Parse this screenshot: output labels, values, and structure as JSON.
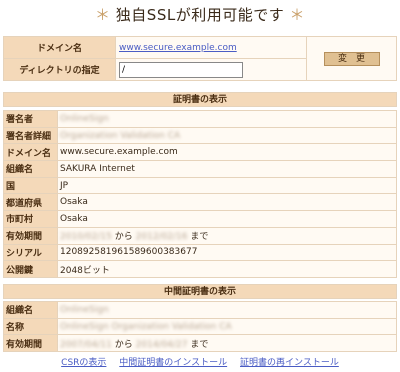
{
  "page": {
    "title_prefix": "＊",
    "title": "独自SSLが利用可能です",
    "title_suffix": "＊"
  },
  "form": {
    "domain_label": "ドメイン名",
    "domain_value": "www.secure.example.com",
    "dir_label": "ディレクトリの指定",
    "dir_value": "/",
    "change_button": "変　更"
  },
  "certificate": {
    "heading": "証明書の表示",
    "rows": [
      {
        "label": "署名者",
        "value": "OnlineSign"
      },
      {
        "label": "署名者詳細",
        "value": "Organization Validation CA"
      },
      {
        "label": "ドメイン名",
        "value": "www.secure.example.com"
      },
      {
        "label": "組織名",
        "value": "SAKURA Internet"
      },
      {
        "label": "国",
        "value": "JP"
      },
      {
        "label": "都道府県",
        "value": "Osaka"
      },
      {
        "label": "市町村",
        "value": "Osaka"
      }
    ],
    "validity": {
      "label": "有効期間",
      "from": "2010/02/15",
      "from_word": "から",
      "to": "2012/02/16",
      "to_word": "まで"
    },
    "serial": {
      "label": "シリアル",
      "value": "120892581961589600383677"
    },
    "pubkey": {
      "label": "公開鍵",
      "value": "2048ビット"
    }
  },
  "intermediate": {
    "heading": "中間証明書の表示",
    "rows": [
      {
        "label": "組織名",
        "value": "OnlineSign"
      },
      {
        "label": "名称",
        "value": "OnlineSign Organization Validation CA"
      }
    ],
    "validity": {
      "label": "有効期間",
      "from": "2007/04/11",
      "from_word": "から",
      "to": "2014/04/27",
      "to_word": "まで"
    }
  },
  "footer": {
    "links": [
      "CSRの表示",
      "中間証明書のインストール",
      "証明書の再インストール"
    ]
  }
}
